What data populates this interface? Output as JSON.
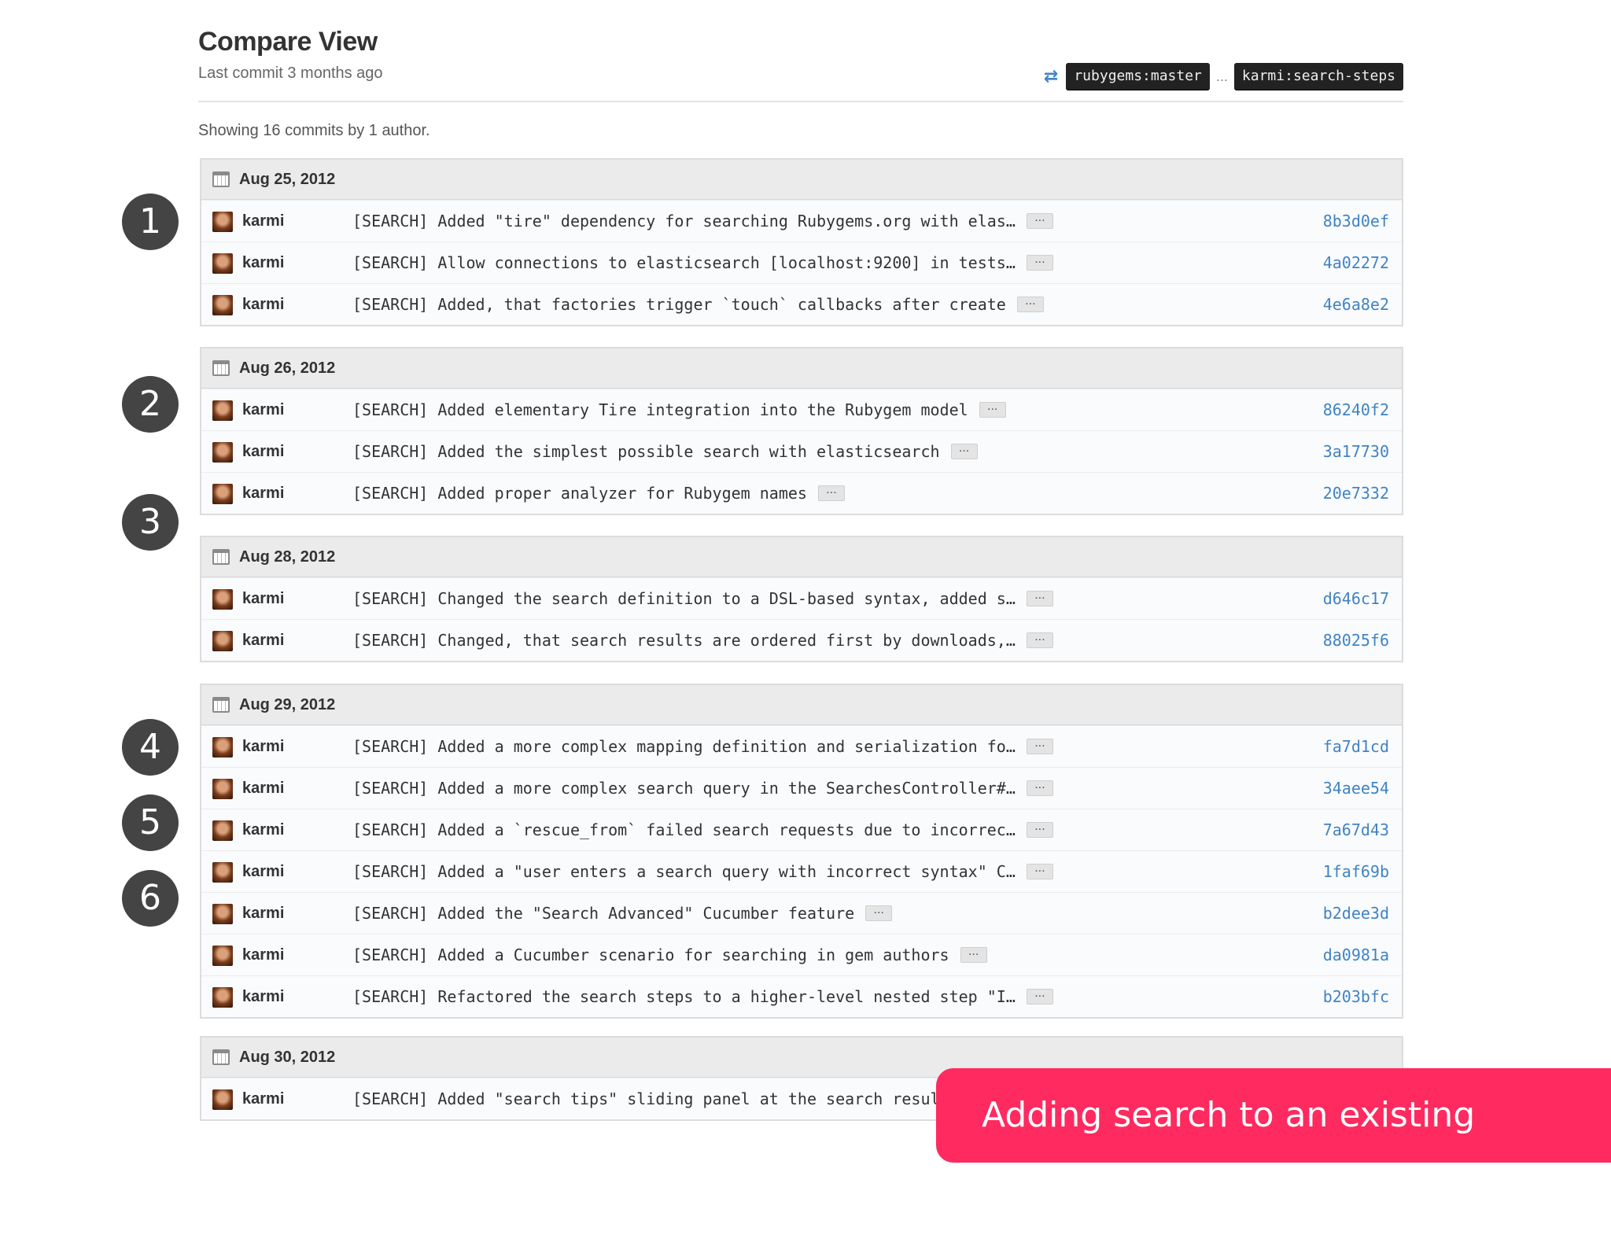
{
  "header": {
    "title": "Compare View",
    "subtitle": "Last commit 3 months ago",
    "base_ref": "rubygems:master",
    "ref_separator": "...",
    "head_ref": "karmi:search-steps"
  },
  "summary": "Showing 16 commits by 1 author.",
  "groups": [
    {
      "date": "Aug 25, 2012",
      "commits": [
        {
          "author": "karmi",
          "message": "[SEARCH] Added \"tire\" dependency for searching Rubygems.org with elas…",
          "sha": "8b3d0ef"
        },
        {
          "author": "karmi",
          "message": "[SEARCH] Allow connections to elasticsearch [localhost:9200] in tests…",
          "sha": "4a02272"
        },
        {
          "author": "karmi",
          "message": "[SEARCH] Added, that factories trigger `touch` callbacks after create",
          "sha": "4e6a8e2"
        }
      ]
    },
    {
      "date": "Aug 26, 2012",
      "commits": [
        {
          "author": "karmi",
          "message": "[SEARCH] Added elementary Tire integration into the Rubygem model",
          "sha": "86240f2"
        },
        {
          "author": "karmi",
          "message": "[SEARCH] Added the simplest possible search with elasticsearch",
          "sha": "3a17730"
        },
        {
          "author": "karmi",
          "message": "[SEARCH] Added proper analyzer for Rubygem names",
          "sha": "20e7332"
        }
      ]
    },
    {
      "date": "Aug 28, 2012",
      "commits": [
        {
          "author": "karmi",
          "message": "[SEARCH] Changed the search definition to a DSL-based syntax, added s…",
          "sha": "d646c17"
        },
        {
          "author": "karmi",
          "message": "[SEARCH] Changed, that search results are ordered first by downloads,…",
          "sha": "88025f6"
        }
      ]
    },
    {
      "date": "Aug 29, 2012",
      "commits": [
        {
          "author": "karmi",
          "message": "[SEARCH] Added a more complex mapping definition and serialization fo…",
          "sha": "fa7d1cd"
        },
        {
          "author": "karmi",
          "message": "[SEARCH] Added a more complex search query in the SearchesController#…",
          "sha": "34aee54"
        },
        {
          "author": "karmi",
          "message": "[SEARCH] Added a `rescue_from` failed search requests due to incorrec…",
          "sha": "7a67d43"
        },
        {
          "author": "karmi",
          "message": "[SEARCH] Added a \"user enters a search query with incorrect syntax\" C…",
          "sha": "1faf69b"
        },
        {
          "author": "karmi",
          "message": "[SEARCH] Added the \"Search Advanced\" Cucumber feature",
          "sha": "b2dee3d"
        },
        {
          "author": "karmi",
          "message": "[SEARCH] Added a Cucumber scenario for searching in gem authors",
          "sha": "da0981a"
        },
        {
          "author": "karmi",
          "message": "[SEARCH] Refactored the search steps to a higher-level nested step \"I…",
          "sha": "b203bfc"
        }
      ]
    },
    {
      "date": "Aug 30, 2012",
      "commits": [
        {
          "author": "karmi",
          "message": "[SEARCH] Added \"search tips\" sliding panel at the search resul",
          "sha": ""
        }
      ]
    }
  ],
  "more_label": "...",
  "badges": [
    "1",
    "2",
    "3",
    "4",
    "5",
    "6"
  ],
  "banner": "Adding search to an existing application",
  "colors": {
    "sha_link": "#4183c4",
    "banner_bg": "#ff2a5f",
    "badge_bg": "#444444"
  }
}
